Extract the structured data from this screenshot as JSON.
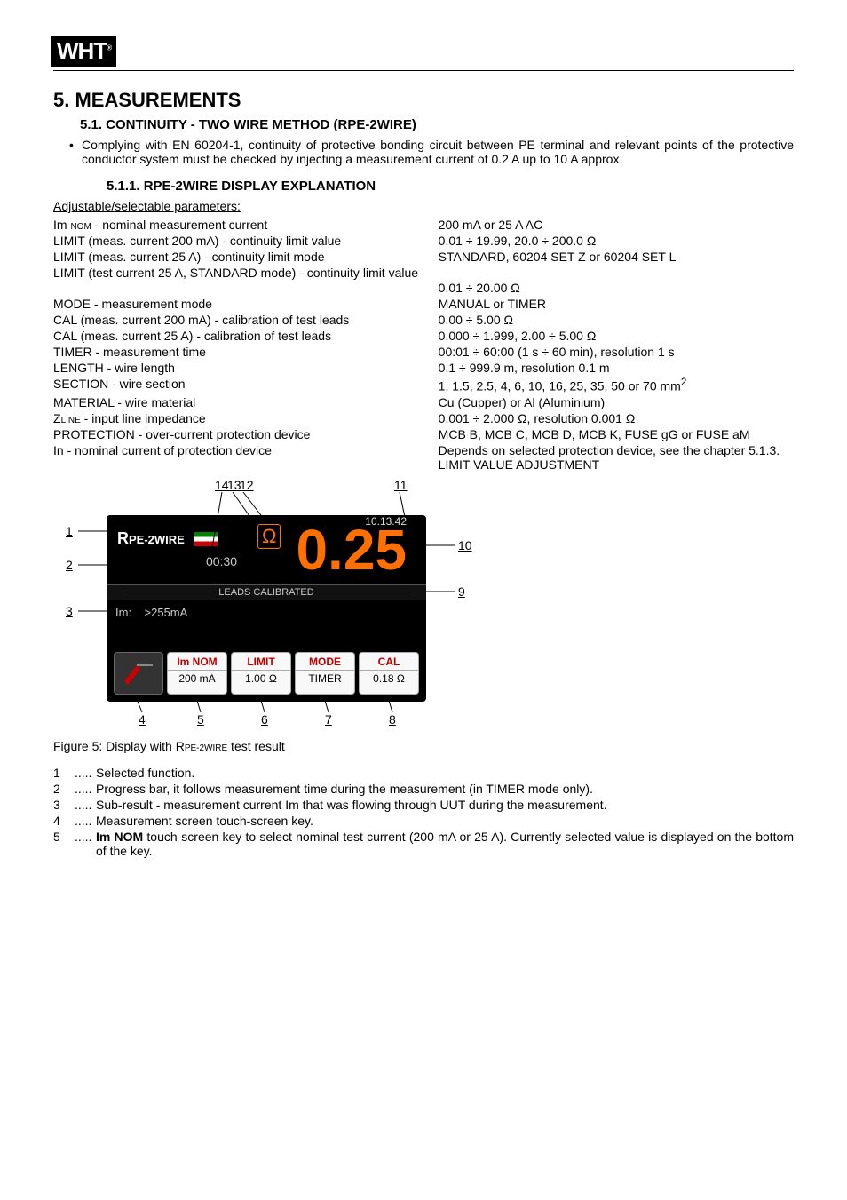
{
  "logo": "WHT",
  "h1": "5.  MEASUREMENTS",
  "h2": "5.1. CONTINUITY - TWO WIRE METHOD (RPE-2WIRE)",
  "intro": "Complying with EN 60204-1, continuity of protective bonding circuit between PE terminal and relevant points of the protective conductor system must be checked by injecting a measurement current of 0.2 A up to 10 A approx.",
  "h3": "5.1.1. RPE-2WIRE DISPLAY EXPLANATION",
  "params_heading": "Adjustable/selectable parameters:",
  "params": [
    {
      "l_pre": "Im ",
      "l_sub": "NOM",
      "l_post": " - nominal measurement current",
      "r": "200 mA or 25 A AC"
    },
    {
      "l": "LIMIT (meas. current 200 mA) - continuity limit value",
      "r": "0.01 ÷ 19.99, 20.0 ÷ 200.0 Ω"
    },
    {
      "l": "LIMIT (meas. current 25 A) - continuity limit mode",
      "r": "STANDARD, 60204 SET Z or 60204 SET L"
    },
    {
      "l": "LIMIT (test current 25 A, STANDARD mode) - continuity limit value",
      "r": "0.01 ÷ 20.00 Ω"
    },
    {
      "l": "MODE - measurement mode",
      "r": "MANUAL or TIMER"
    },
    {
      "l": "CAL (meas. current 200 mA) - calibration of test leads",
      "r": "0.00 ÷ 5.00 Ω"
    },
    {
      "l": "CAL (meas. current 25 A) - calibration of test leads",
      "r": "0.000 ÷ 1.999, 2.00 ÷ 5.00 Ω"
    },
    {
      "l": "TIMER - measurement time",
      "r": "00:01 ÷ 60:00 (1 s ÷ 60 min), resolution 1 s"
    },
    {
      "l": "LENGTH - wire length",
      "r": "0.1 ÷ 999.9 m, resolution 0.1 m"
    },
    {
      "l": "SECTION - wire section",
      "r_pre": "1, 1.5, 2.5, 4, 6, 10, 16, 25, 35, 50 or 70 mm",
      "r_sup": "2"
    },
    {
      "l": "MATERIAL - wire material",
      "r": "Cu (Cupper) or Al (Aluminium)"
    },
    {
      "l_pre": "Z",
      "l_sub": "LINE",
      "l_post": " - input line impedance",
      "r": "0.001 ÷ 2.000 Ω, resolution 0.001 Ω"
    },
    {
      "l": "PROTECTION - over-current protection device",
      "r": "MCB B, MCB C, MCB D, MCB K, FUSE gG or FUSE aM"
    },
    {
      "l": "In - nominal current of protection device",
      "r": "Depends on selected protection device, see the chapter 5.1.3. LIMIT VALUE ADJUSTMENT"
    }
  ],
  "display": {
    "title_pre": "R",
    "title_sub": "PE-2WIRE",
    "timer": "00:30",
    "ohm": "Ω",
    "value": "0.25",
    "clock": "10.13.42",
    "leads": "LEADS CALIBRATED",
    "sub_l": "Im:",
    "sub_v": ">255mA",
    "sk": [
      {
        "top": "Im NOM",
        "bot": "200 mA"
      },
      {
        "top": "LIMIT",
        "bot": "1.00 Ω"
      },
      {
        "top": "MODE",
        "bot": "TIMER"
      },
      {
        "top": "CAL",
        "bot": "0.18 Ω"
      }
    ]
  },
  "callouts": {
    "1": "1",
    "2": "2",
    "3": "3",
    "4": "4",
    "5": "5",
    "6": "6",
    "7": "7",
    "8": "8",
    "9": "9",
    "10": "10",
    "11": "11",
    "12": "12",
    "13": "13",
    "14": "14"
  },
  "fig_caption_pre": "Figure 5: Display with R",
  "fig_caption_sub": "PE-2WIRE",
  "fig_caption_post": " test result",
  "notes": [
    {
      "n": "1",
      "t": "Selected function."
    },
    {
      "n": "2",
      "t": "Progress bar, it follows measurement time during the measurement (in TIMER mode only)."
    },
    {
      "n": "3",
      "t": "Sub-result - measurement current Im that was flowing through UUT during the measurement."
    },
    {
      "n": "4",
      "t": "Measurement screen touch-screen key."
    },
    {
      "n": "5",
      "t_pre": "",
      "t_bold": "Im NOM",
      "t_post": " touch-screen key to select nominal test current (200 mA or 25 A). Currently selected value is displayed on the bottom of the key."
    }
  ]
}
